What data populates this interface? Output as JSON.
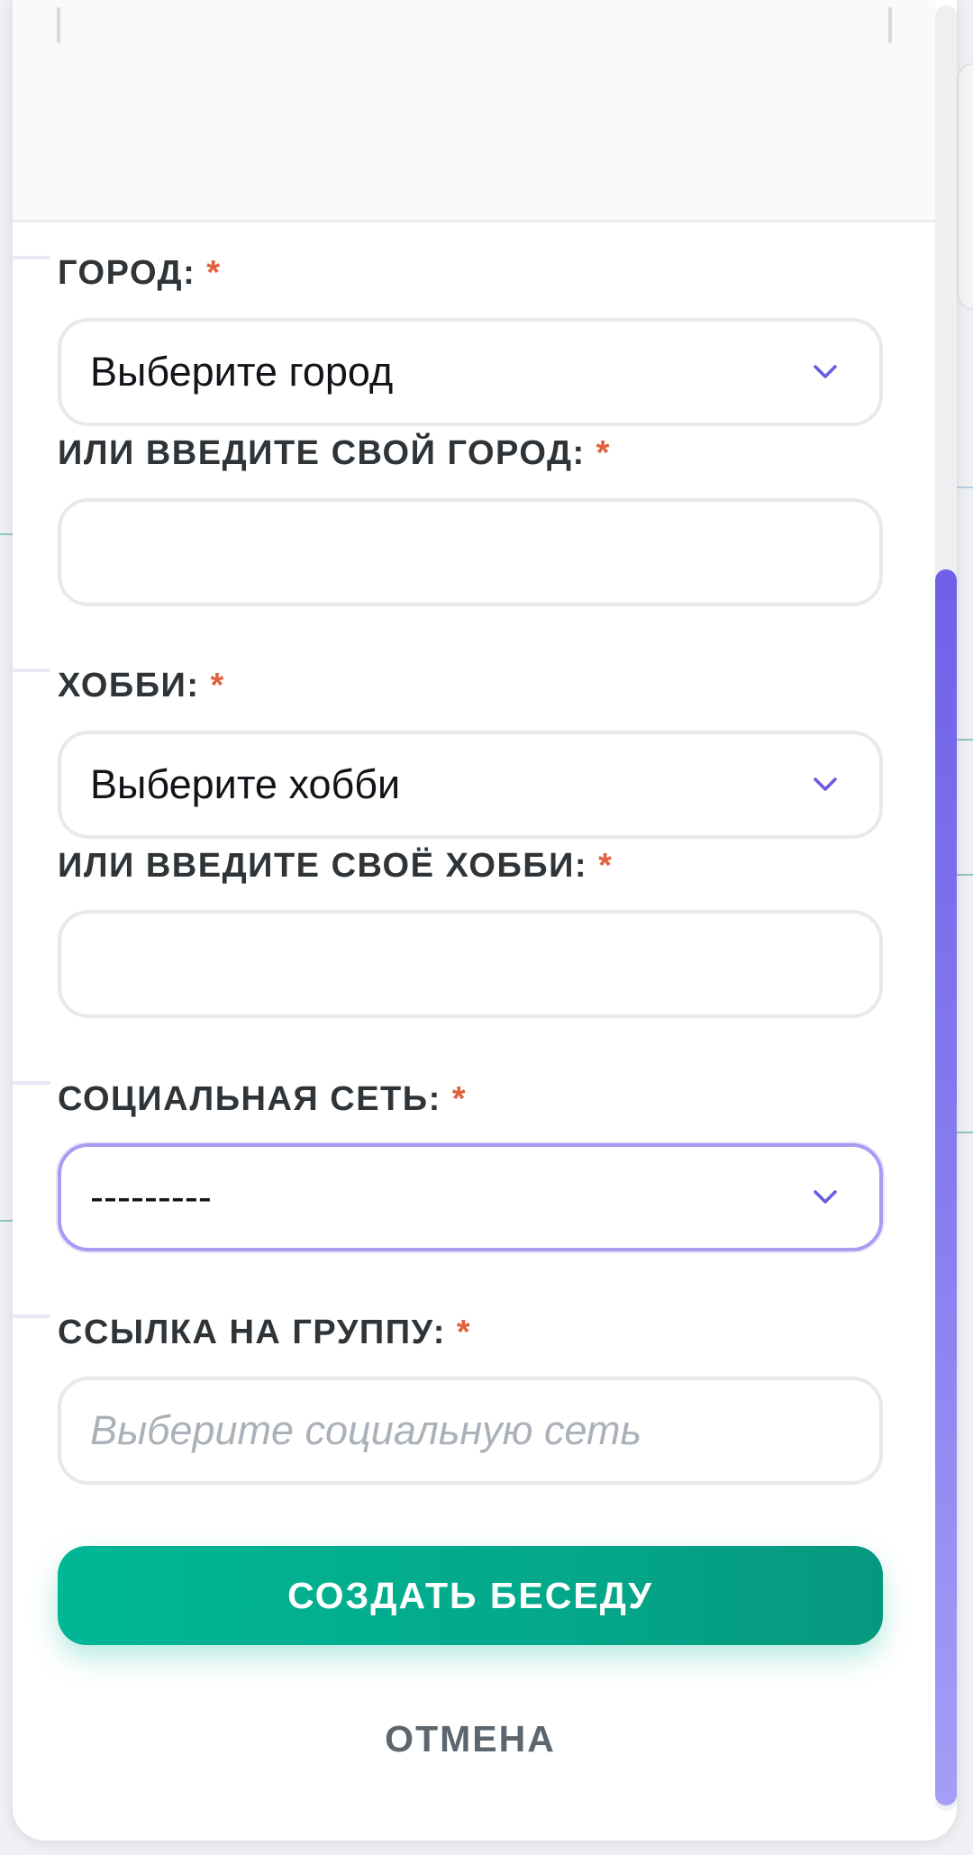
{
  "form": {
    "city": {
      "label": "ГОРОД:",
      "required_mark": "*",
      "selected": "Выберите город"
    },
    "custom_city": {
      "label": "ИЛИ ВВЕДИТЕ СВОЙ ГОРОД:",
      "required_mark": "*",
      "value": ""
    },
    "hobby": {
      "label": "ХОББИ:",
      "required_mark": "*",
      "selected": "Выберите хобби"
    },
    "custom_hobby": {
      "label": "ИЛИ ВВЕДИТЕ СВОЁ ХОББИ:",
      "required_mark": "*",
      "value": ""
    },
    "social_network": {
      "label": "СОЦИАЛЬНАЯ СЕТЬ:",
      "required_mark": "*",
      "selected": "---------"
    },
    "group_link": {
      "label": "ССЫЛКА НА ГРУППУ:",
      "required_mark": "*",
      "placeholder": "Выберите социальную сеть",
      "value": ""
    },
    "submit_label": "СОЗДАТЬ БЕСЕДУ",
    "cancel_label": "ОТМЕНА"
  },
  "icons": {
    "select_arrow": "chevron-down-icon"
  },
  "colors": {
    "accent": "#7060e8",
    "required": "#e0613e",
    "submit": "#00b794",
    "focus_border": "#a79cf2"
  }
}
